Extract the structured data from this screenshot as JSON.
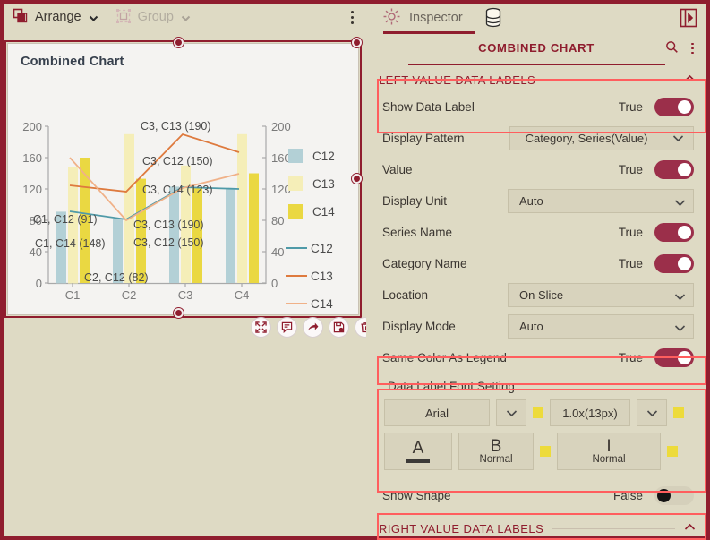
{
  "toolbar": {
    "arrange_label": "Arrange",
    "group_label": "Group",
    "arrange_icon": "overlapping-squares-icon",
    "group_icon": "group-shape-icon",
    "more_icon": "vertical-dots-icon"
  },
  "inspector": {
    "tab_label": "Inspector",
    "gear_icon": "gear-icon",
    "data_icon": "database-icon",
    "collapse_icon": "panel-collapse-icon"
  },
  "panel": {
    "title": "COMBINED CHART",
    "search_icon": "search-icon",
    "more_icon": "vertical-dots-icon"
  },
  "sections": {
    "left_value": "LEFT VALUE DATA LABELS",
    "right_value": "RIGHT VALUE DATA LABELS",
    "collapse_caret": "chevron-up-icon"
  },
  "properties": [
    {
      "name": "Show Data Label",
      "value": "True",
      "type": "toggle",
      "state": "on",
      "highlighted": true
    },
    {
      "name": "Display Pattern",
      "value": "Category, Series(Value)",
      "type": "select-split"
    },
    {
      "name": "Value",
      "value": "True",
      "type": "toggle",
      "state": "on"
    },
    {
      "name": "Display Unit",
      "value": "Auto",
      "type": "select"
    },
    {
      "name": "Series Name",
      "value": "True",
      "type": "toggle",
      "state": "on"
    },
    {
      "name": "Category Name",
      "value": "True",
      "type": "toggle",
      "state": "on"
    },
    {
      "name": "Location",
      "value": "On Slice",
      "type": "select"
    },
    {
      "name": "Display Mode",
      "value": "Auto",
      "type": "select"
    },
    {
      "name": "Same Color As Legend",
      "value": "True",
      "type": "toggle",
      "state": "on",
      "highlighted": true
    },
    {
      "name": "Show Shape",
      "value": "False",
      "type": "toggle",
      "state": "off"
    }
  ],
  "font_setting": {
    "title": "Data Label Font Setting",
    "family": "Arial",
    "size": "1.0x(13px)",
    "color_glyph": "A",
    "bold_glyph": "B",
    "bold_value": "Normal",
    "italic_glyph": "I",
    "italic_value": "Normal",
    "swatch_color": "#eddb3b"
  },
  "chart_data": {
    "type": "bar",
    "title": "Combined Chart",
    "categories": [
      "C1",
      "C2",
      "C3",
      "C4"
    ],
    "series": [
      {
        "name": "C12",
        "kind": "bar",
        "color": "#b3d0d6",
        "values": [
          91,
          82,
          123,
          120
        ]
      },
      {
        "name": "C13",
        "kind": "bar",
        "color": "#f5eeb8",
        "values": [
          148,
          190,
          150,
          190
        ]
      },
      {
        "name": "C14",
        "kind": "bar",
        "color": "#ead842",
        "values": [
          160,
          133,
          121,
          140
        ]
      },
      {
        "name": "C12",
        "kind": "line",
        "color": "#4f9aa8",
        "values": [
          91,
          82,
          123,
          120
        ]
      },
      {
        "name": "C13",
        "kind": "line",
        "color": "#de7a3e",
        "values": [
          125,
          118,
          190,
          170
        ]
      },
      {
        "name": "C14",
        "kind": "line",
        "color": "#f0b188",
        "values": [
          160,
          80,
          121,
          140
        ]
      }
    ],
    "left_axis": {
      "ticks": [
        0,
        40,
        80,
        120,
        160,
        200
      ],
      "ylim": [
        0,
        200
      ]
    },
    "right_axis": {
      "ticks": [
        0,
        40,
        80,
        120,
        160,
        200
      ],
      "ylim": [
        0,
        200
      ]
    },
    "legend_position": "right",
    "grid": false,
    "annotations": [
      "C3, C13 (190)",
      "C3, C12 (150)",
      "C3, C14 (123)",
      "C1, C12 (91)",
      "C1, C14 (148)",
      "C3, C13 (190)",
      "C3, C12 (150)",
      "C2, C12 (82)"
    ]
  },
  "chart_actions": [
    {
      "icon": "expand-icon",
      "name": "expand-button"
    },
    {
      "icon": "comment-icon",
      "name": "comment-button"
    },
    {
      "icon": "share-icon",
      "name": "share-button"
    },
    {
      "icon": "save-chart-icon",
      "name": "save-button"
    },
    {
      "icon": "trash-icon",
      "name": "delete-button"
    }
  ]
}
